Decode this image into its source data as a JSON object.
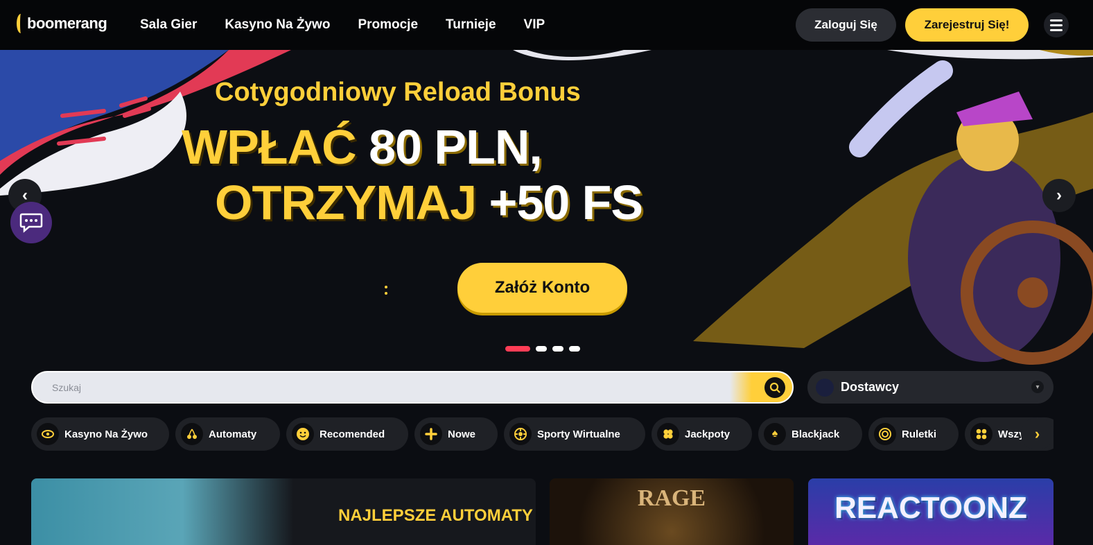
{
  "header": {
    "logo": "boomerang",
    "nav": [
      "Sala Gier",
      "Kasyno Na Żywo",
      "Promocje",
      "Turnieje",
      "VIP"
    ],
    "login_label": "Zaloguj Się",
    "register_label": "Zarejestruj Się!"
  },
  "hero": {
    "subtitle": "Cotygodniowy Reload Bonus",
    "line1_yellow": "WPŁAĆ",
    "line1_white": "80 PLN,",
    "line2_yellow": "OTRZYMAJ",
    "line2_white": "+50 FS",
    "cta_label": "Załóż Konto",
    "slides_count": 4,
    "active_slide": 1
  },
  "search": {
    "placeholder": "Szukaj",
    "providers_label": "Dostawcy"
  },
  "categories": [
    {
      "label": "Kasyno Na Żywo",
      "icon": "eye-icon"
    },
    {
      "label": "Automaty",
      "icon": "cherries-icon"
    },
    {
      "label": "Recomended",
      "icon": "smiley-icon"
    },
    {
      "label": "Nowe",
      "icon": "plus-icon"
    },
    {
      "label": "Sporty Wirtualne",
      "icon": "wheel-icon"
    },
    {
      "label": "Jackpoty",
      "icon": "clover-icon"
    },
    {
      "label": "Blackjack",
      "icon": "spade-icon"
    },
    {
      "label": "Ruletki",
      "icon": "roulette-icon"
    },
    {
      "label": "Wszy",
      "icon": "grid-icon"
    }
  ],
  "tiles": {
    "main_title": "NAJLEPSZE AUTOMATY",
    "rage_title": "RAGE",
    "reactoonz_title": "REACTOONZ"
  },
  "colors": {
    "accent": "#ffcf3a",
    "active_dot": "#ff3d56",
    "background": "#0b0d12",
    "chat": "#4b2a7d"
  }
}
